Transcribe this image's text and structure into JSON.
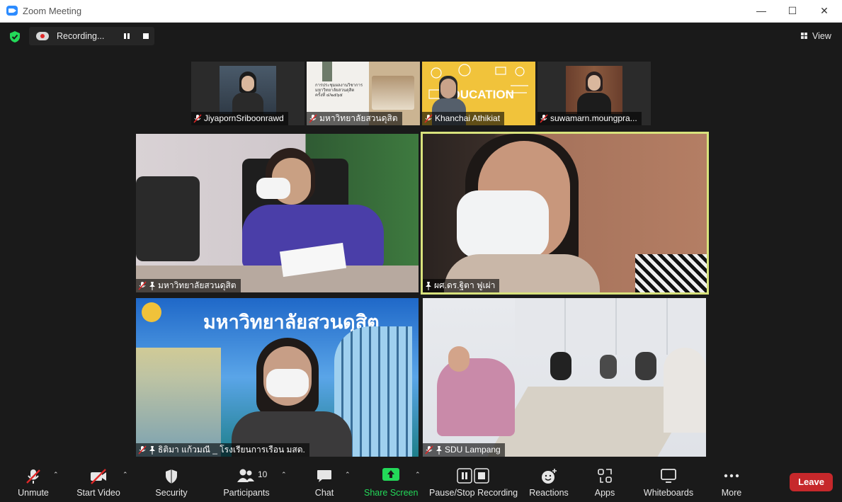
{
  "window": {
    "title": "Zoom Meeting"
  },
  "recording": {
    "label": "Recording..."
  },
  "view": {
    "label": "View"
  },
  "thumbnails": [
    {
      "name": "JiyapornSriboonrawd"
    },
    {
      "name": "มหาวิทยาลัยสวนดุสิต"
    },
    {
      "name": "Khanchai Athikiat"
    },
    {
      "name": "suwamarn.moungpra..."
    }
  ],
  "tiles": [
    {
      "name": "มหาวิทยาลัยสวนดุสิต",
      "muted": true,
      "pinned": true
    },
    {
      "name": "ผศ.ดร.ฐิตา ฟูเผ่า",
      "muted": false,
      "pinned": true,
      "active_speaker": true
    },
    {
      "name": "ธิติมา แก้วมณี _ โรงเรียนการเรือน มสด.",
      "muted": true,
      "pinned": true,
      "banner": "มหาวิทยาลัยสวนดุสิต"
    },
    {
      "name": "SDU Lampang",
      "muted": true,
      "pinned": true
    }
  ],
  "slide_thumb": {
    "line1": "การประชุมผลงานวิชาการ",
    "line2": "มหาวิทยาลัยสวนดุสิต",
    "line3": "ครั้งที่ ๔/๒๕๖๕"
  },
  "toolbar": {
    "unmute": "Unmute",
    "start_video": "Start Video",
    "security": "Security",
    "participants": "Participants",
    "participants_count": "10",
    "chat": "Chat",
    "share_screen": "Share Screen",
    "pause_stop_recording": "Pause/Stop Recording",
    "reactions": "Reactions",
    "apps": "Apps",
    "whiteboards": "Whiteboards",
    "more": "More",
    "leave": "Leave"
  },
  "colors": {
    "accent_green": "#23d959",
    "active_border": "#d8e27c",
    "leave_red": "#c6282b",
    "zoom_blue": "#2d8cff"
  }
}
